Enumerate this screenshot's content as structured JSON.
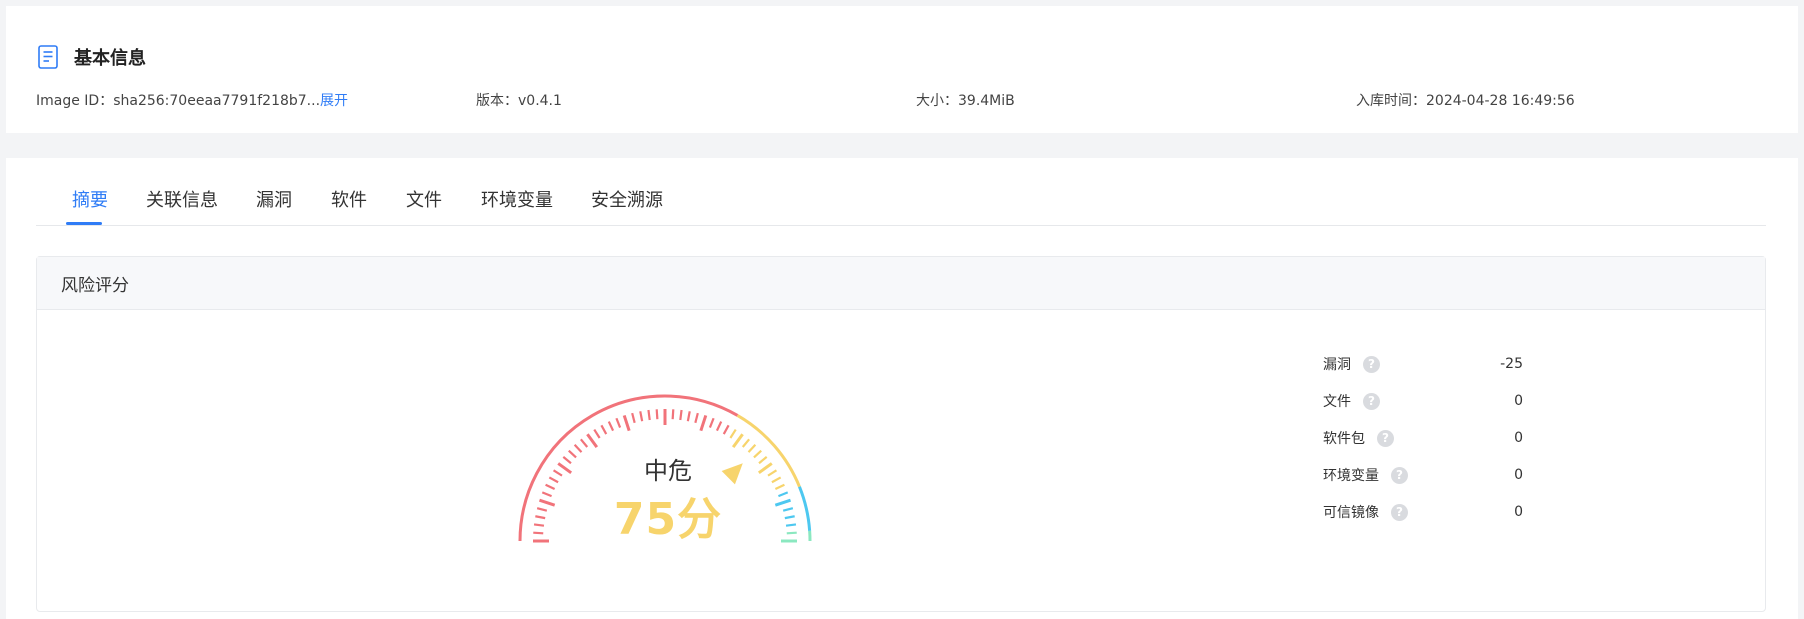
{
  "basic_info": {
    "title": "基本信息",
    "icon": "document-icon",
    "image_id_label": "Image ID：",
    "image_id_value": "sha256:70eeaa7791f218b7...",
    "expand_link": "展开",
    "version_label": "版本：",
    "version_value": "v0.4.1",
    "size_label": "大小：",
    "size_value": "39.4MiB",
    "time_label": "入库时间：",
    "time_value": "2024-04-28 16:49:56"
  },
  "tabs": [
    {
      "label": "摘要",
      "active": true
    },
    {
      "label": "关联信息",
      "active": false
    },
    {
      "label": "漏洞",
      "active": false
    },
    {
      "label": "软件",
      "active": false
    },
    {
      "label": "文件",
      "active": false
    },
    {
      "label": "环境变量",
      "active": false
    },
    {
      "label": "安全溯源",
      "active": false
    }
  ],
  "risk": {
    "title": "风险评分",
    "level": "中危",
    "score_text": "75分",
    "score": 75,
    "colors": {
      "red": "#f1737a",
      "yellow": "#f7d46c",
      "cyan": "#4dc8f0",
      "green": "#8be8c0",
      "score": "#f7d46c"
    },
    "items": [
      {
        "label": "漏洞",
        "value": "-25"
      },
      {
        "label": "文件",
        "value": "0"
      },
      {
        "label": "软件包",
        "value": "0"
      },
      {
        "label": "环境变量",
        "value": "0"
      },
      {
        "label": "可信镜像",
        "value": "0"
      }
    ]
  }
}
